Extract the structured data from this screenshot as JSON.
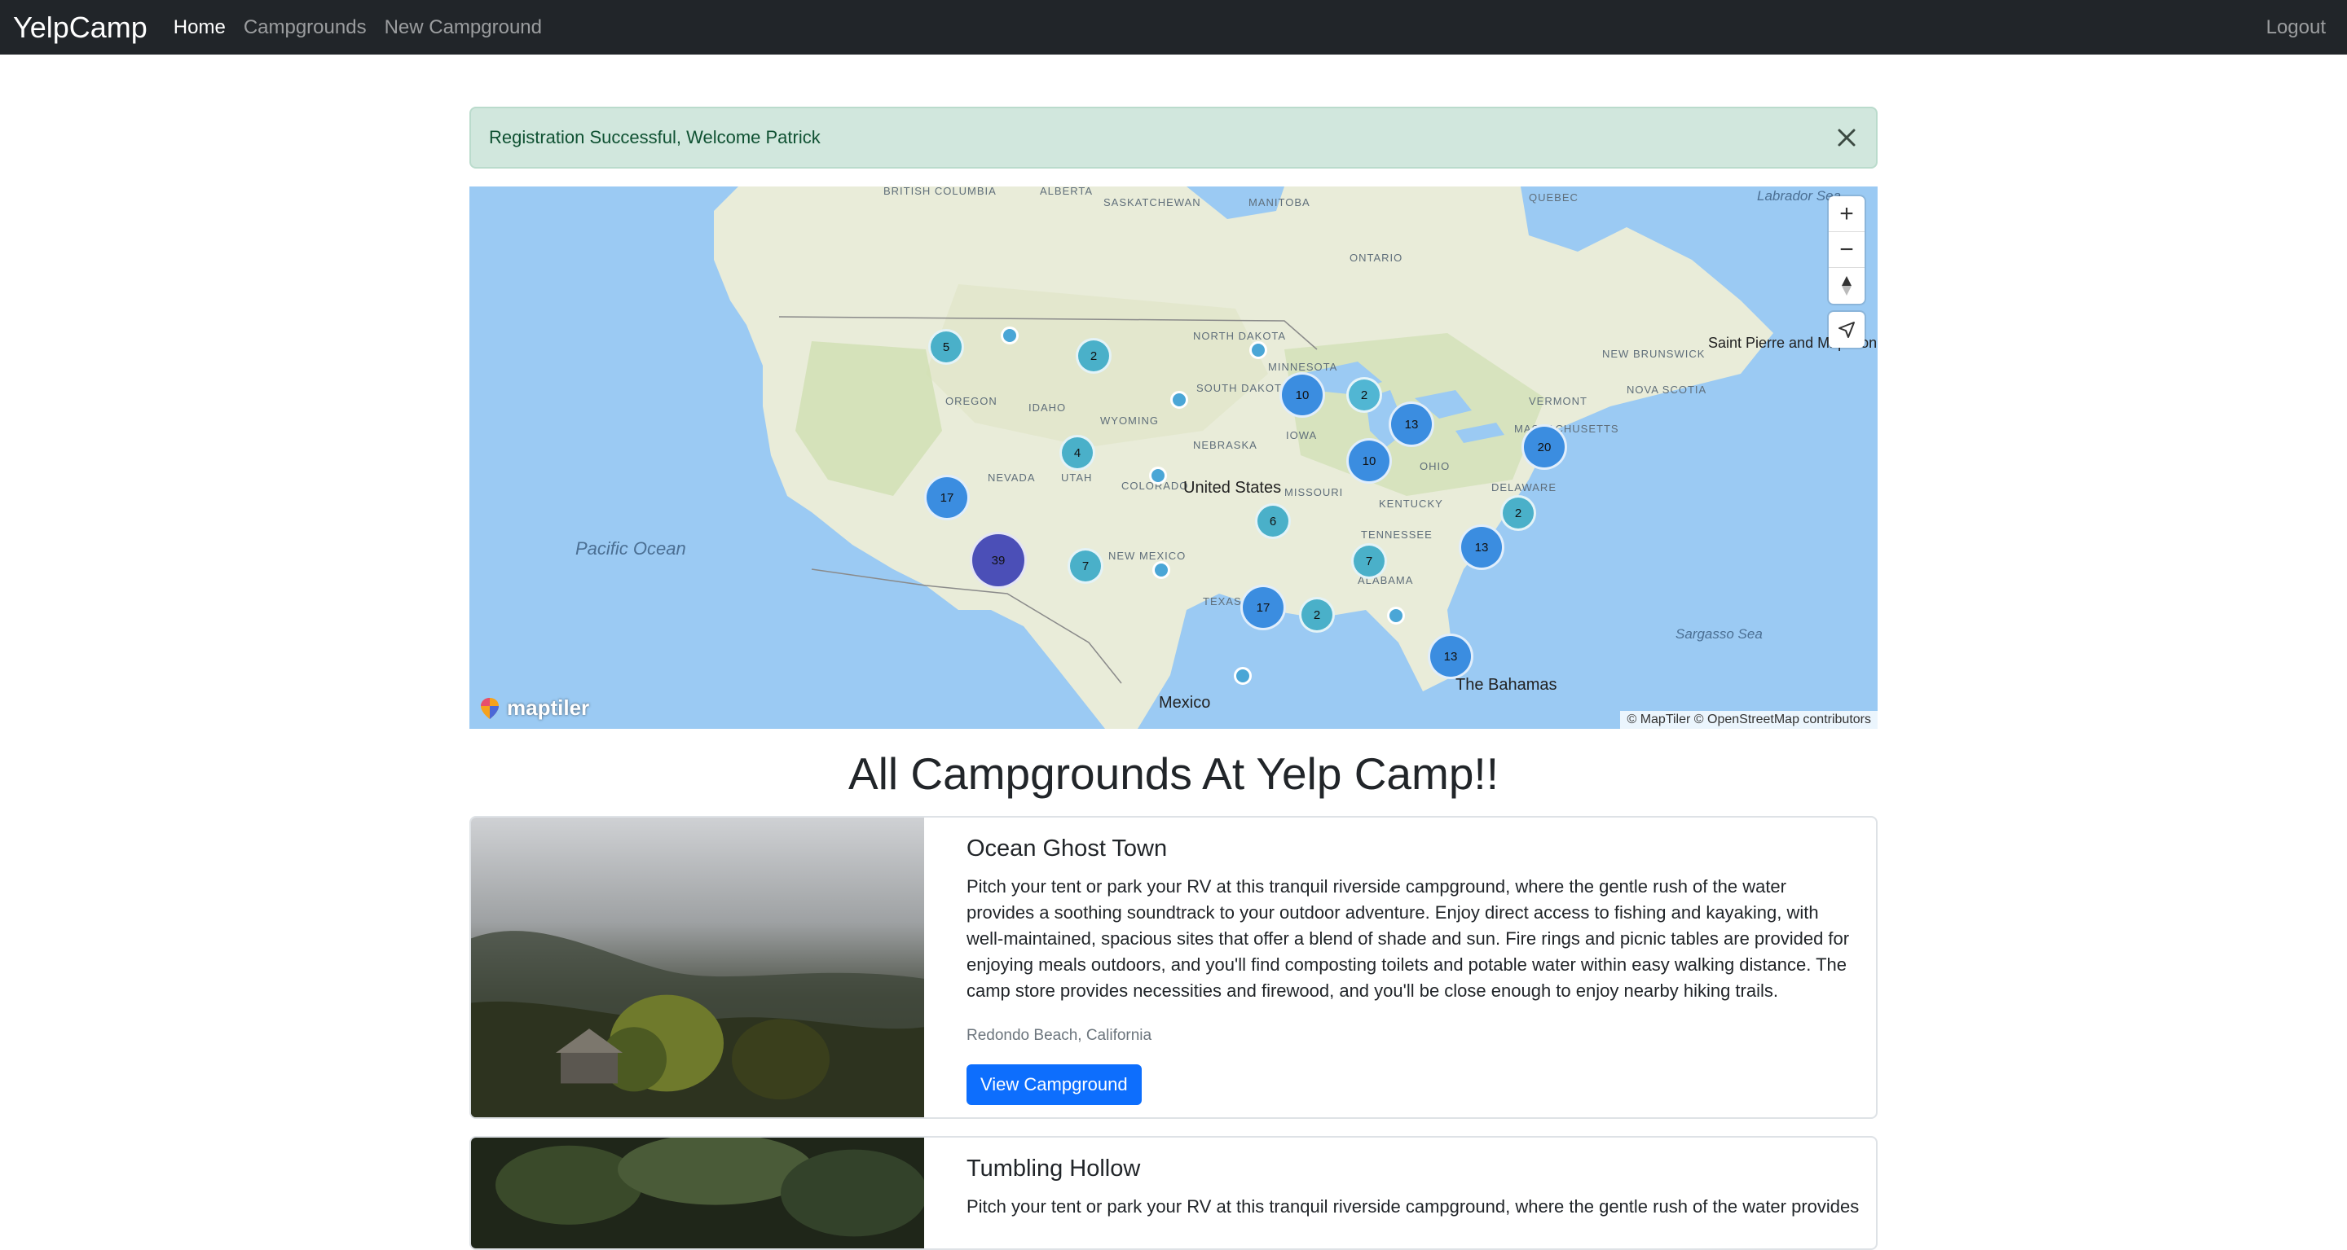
{
  "navbar": {
    "brand": "YelpCamp",
    "links": [
      {
        "label": "Home",
        "active": true
      },
      {
        "label": "Campgrounds",
        "active": false
      },
      {
        "label": "New Campground",
        "active": false
      }
    ],
    "logout": "Logout"
  },
  "alert": {
    "message": "Registration Successful, Welcome Patrick",
    "color": "#d1e7dd"
  },
  "map": {
    "labels": {
      "british_columbia": "British Columbia",
      "alberta": "Alberta",
      "saskatchewan": "Saskatchewan",
      "manitoba": "Manitoba",
      "quebec": "Quebec",
      "ontario": "Ontario",
      "labrador_sea": "Labrador Sea",
      "new_brunswick": "New Brunswick",
      "nova_scotia": "Nova Scotia",
      "saint_pierre": "Saint Pierre and Miquelon",
      "north_dakota": "North Dakota",
      "south_dakota": "South Dakota",
      "minnesota": "Minnesota",
      "oregon": "Oregon",
      "idaho": "Idaho",
      "wyoming": "Wyoming",
      "nebraska": "Nebraska",
      "iowa": "Iowa",
      "vermont": "Vermont",
      "massachusetts": "Massachusetts",
      "nevada": "Nevada",
      "utah": "Utah",
      "colorado": "Colorado",
      "missouri": "Missouri",
      "ohio": "Ohio",
      "kentucky": "Kentucky",
      "delaware": "Delaware",
      "tennessee": "Tennessee",
      "new_mexico": "New Mexico",
      "alabama": "Alabama",
      "texas": "Texas",
      "united_states": "United States",
      "pacific_ocean": "Pacific Ocean",
      "mexico": "Mexico",
      "bahamas": "The Bahamas",
      "sargasso_sea": "Sargasso Sea"
    },
    "clusters": [
      "5",
      "2",
      "10",
      "2",
      "13",
      "20",
      "10",
      "4",
      "17",
      "39",
      "7",
      "6",
      "2",
      "7",
      "13",
      "17",
      "2",
      "13"
    ],
    "controls": {
      "zoom_in": "+",
      "zoom_out": "−",
      "compass_icon": "compass-icon",
      "geolocate_icon": "location-arrow-icon"
    },
    "attribution": "© MapTiler © OpenStreetMap contributors",
    "logo": "maptiler"
  },
  "heading": "All Campgrounds At Yelp Camp!!",
  "campgrounds": [
    {
      "title": "Ocean Ghost Town",
      "description": "Pitch your tent or park your RV at this tranquil riverside campground, where the gentle rush of the water provides a soothing soundtrack to your outdoor adventure. Enjoy direct access to fishing and kayaking, with well-maintained, spacious sites that offer a blend of shade and sun. Fire rings and picnic tables are provided for enjoying meals outdoors, and you'll find composting toilets and potable water within easy walking distance. The camp store provides necessities and firewood, and you'll be close enough to enjoy nearby hiking trails.",
      "location": "Redondo Beach, California",
      "button": "View Campground"
    },
    {
      "title": "Tumbling Hollow",
      "description": "Pitch your tent or park your RV at this tranquil riverside campground, where the gentle rush of the water provides"
    }
  ]
}
